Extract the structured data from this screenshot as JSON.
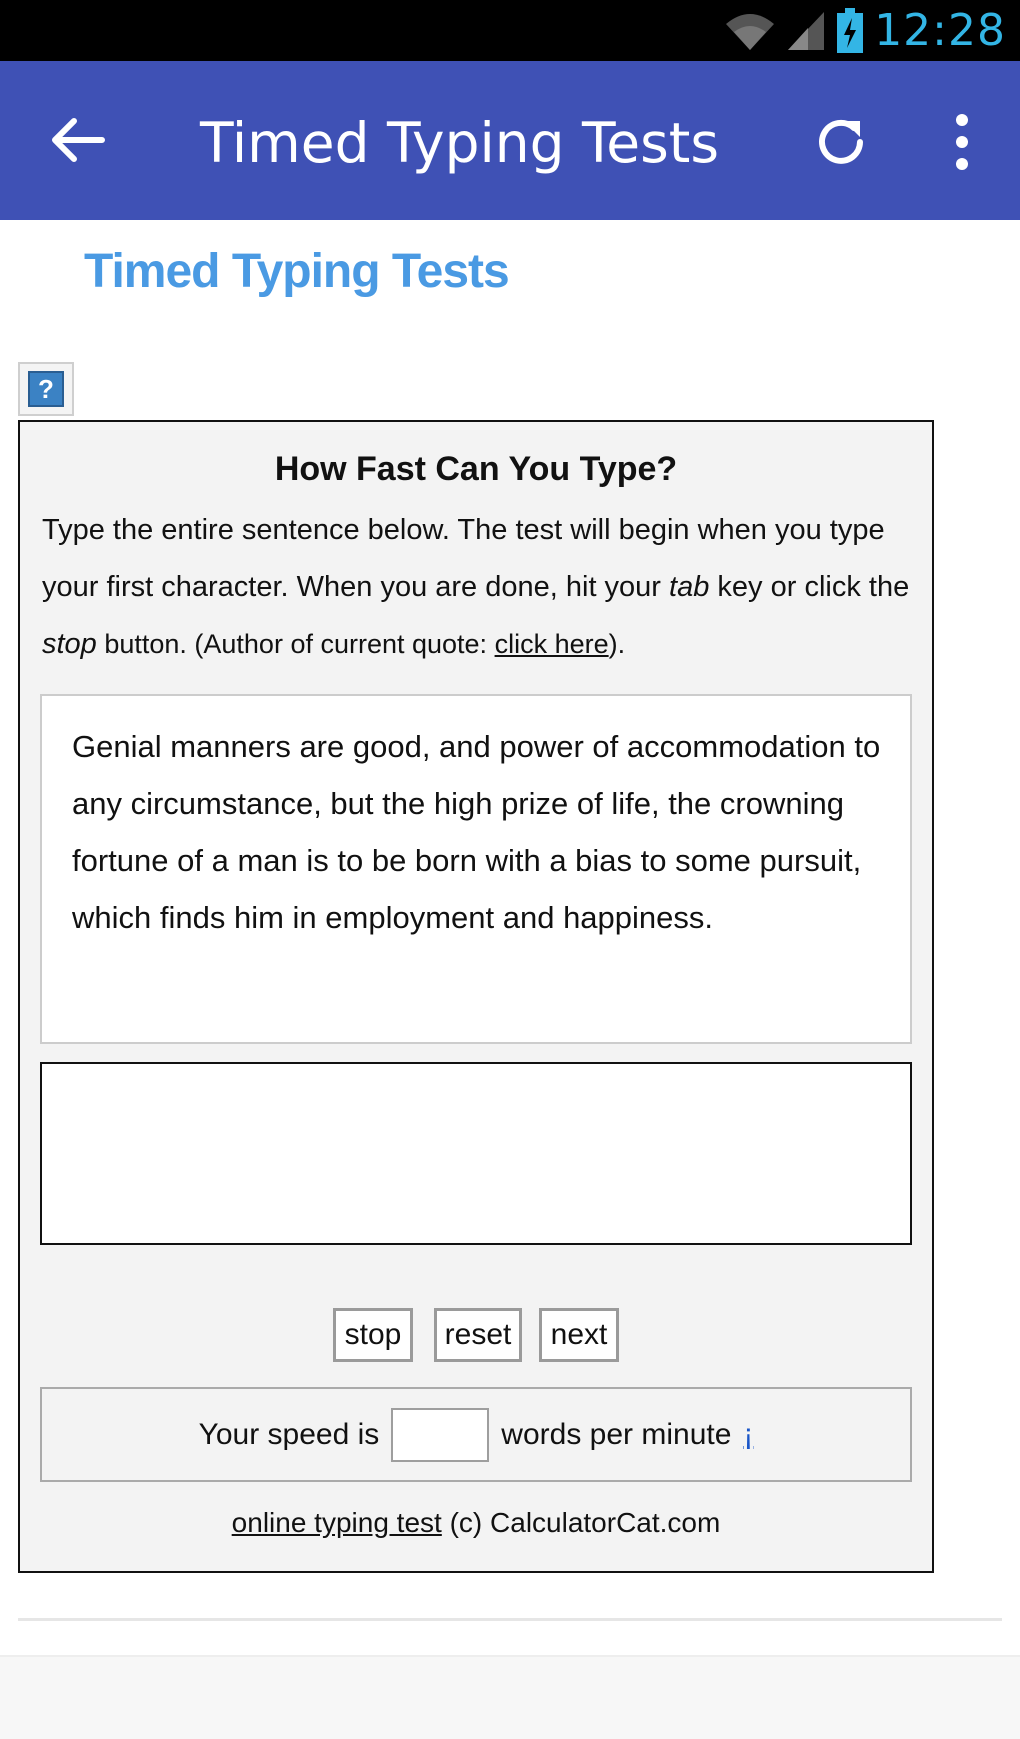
{
  "status_bar": {
    "time": "12:28",
    "icons": [
      "wifi-icon",
      "signal-icon",
      "battery-charging-icon"
    ]
  },
  "app_bar": {
    "title": "Timed Typing Tests",
    "icons": [
      "back-arrow-icon",
      "refresh-icon",
      "more-vert-icon"
    ]
  },
  "page": {
    "heading": "Timed Typing Tests",
    "help_label": "?"
  },
  "panel": {
    "title": "How Fast Can You Type?",
    "instr_1": "Type the entire sentence below. The test will begin when you type your first character. When you are done, hit your ",
    "instr_tab": "tab",
    "instr_2": " key or click the ",
    "instr_stop": "stop",
    "instr_3": " button. (Author of current quote: ",
    "instr_link": "click here",
    "instr_4": ").",
    "quote": "Genial manners are good, and power of accommodation to any circumstance, but the high prize of life, the crowning fortune of a man is to be born with a bias to some pursuit, which finds him in employment and happiness.",
    "typing_value": "",
    "buttons": {
      "stop": "stop",
      "reset": "reset",
      "next": "next"
    },
    "speed": {
      "prefix": "Your speed is",
      "value": "",
      "suffix": "words per minute",
      "link": "¡"
    },
    "footer": {
      "link": "online typing test",
      "text": " (c) CalculatorCat.com"
    }
  }
}
